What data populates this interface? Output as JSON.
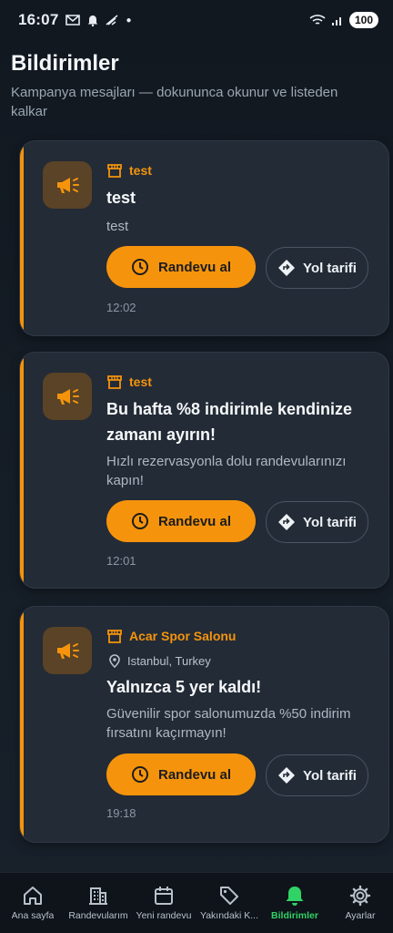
{
  "status_bar": {
    "time": "16:07",
    "battery": "100"
  },
  "header": {
    "title": "Bildirimler",
    "subtitle": "Kampanya mesajları — dokununca okunur ve listeden kalkar"
  },
  "notifications": [
    {
      "store": "test",
      "title": "test",
      "body": "test",
      "primary_label": "Randevu al",
      "secondary_label": "Yol tarifi",
      "time": "12:02"
    },
    {
      "store": "test",
      "title": "Bu hafta %8 indirimle kendinize zamanı ayırın!",
      "body": "Hızlı rezervasyonla dolu randevularınızı kapın!",
      "primary_label": "Randevu al",
      "secondary_label": "Yol tarifi",
      "time": "12:01"
    },
    {
      "store": "Acar Spor Salonu",
      "location": "Istanbul, Turkey",
      "title": "Yalnızca 5 yer kaldı!",
      "body": "Güvenilir spor salonumuzda %50 indirim fırsatını kaçırmayın!",
      "primary_label": "Randevu al",
      "secondary_label": "Yol tarifi",
      "time": "19:18"
    }
  ],
  "bottom_nav": [
    {
      "label": "Ana sayfa",
      "icon": "home-icon"
    },
    {
      "label": "Randevularım",
      "icon": "building-icon"
    },
    {
      "label": "Yeni randevu",
      "icon": "calendar-icon"
    },
    {
      "label": "Yakındaki K...",
      "icon": "tag-icon"
    },
    {
      "label": "Bildirimler",
      "icon": "bell-icon",
      "active": true
    },
    {
      "label": "Ayarlar",
      "icon": "gear-icon"
    }
  ],
  "colors": {
    "accent": "#f5940c",
    "active_nav": "#31d366",
    "card_bg": "#232b36"
  }
}
